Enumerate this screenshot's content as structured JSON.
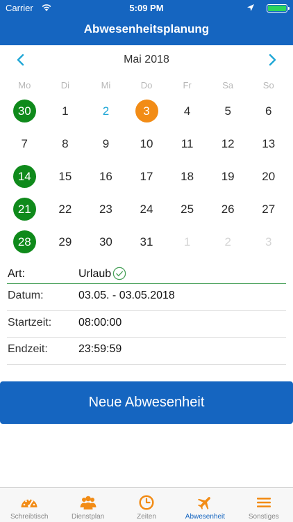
{
  "status_bar": {
    "carrier": "Carrier",
    "time": "5:09 PM"
  },
  "header": {
    "title": "Abwesenheitsplanung"
  },
  "calendar": {
    "month_label": "Mai 2018",
    "weekdays": [
      "Mo",
      "Di",
      "Mi",
      "Do",
      "Fr",
      "Sa",
      "So"
    ],
    "weeks": [
      [
        {
          "d": "30",
          "s": "green"
        },
        {
          "d": "1",
          "s": ""
        },
        {
          "d": "2",
          "s": "today"
        },
        {
          "d": "3",
          "s": "orange"
        },
        {
          "d": "4",
          "s": ""
        },
        {
          "d": "5",
          "s": ""
        },
        {
          "d": "6",
          "s": ""
        }
      ],
      [
        {
          "d": "7",
          "s": ""
        },
        {
          "d": "8",
          "s": ""
        },
        {
          "d": "9",
          "s": ""
        },
        {
          "d": "10",
          "s": ""
        },
        {
          "d": "11",
          "s": ""
        },
        {
          "d": "12",
          "s": ""
        },
        {
          "d": "13",
          "s": ""
        }
      ],
      [
        {
          "d": "14",
          "s": "green"
        },
        {
          "d": "15",
          "s": ""
        },
        {
          "d": "16",
          "s": ""
        },
        {
          "d": "17",
          "s": ""
        },
        {
          "d": "18",
          "s": ""
        },
        {
          "d": "19",
          "s": ""
        },
        {
          "d": "20",
          "s": ""
        }
      ],
      [
        {
          "d": "21",
          "s": "green"
        },
        {
          "d": "22",
          "s": ""
        },
        {
          "d": "23",
          "s": ""
        },
        {
          "d": "24",
          "s": ""
        },
        {
          "d": "25",
          "s": ""
        },
        {
          "d": "26",
          "s": ""
        },
        {
          "d": "27",
          "s": ""
        }
      ],
      [
        {
          "d": "28",
          "s": "green"
        },
        {
          "d": "29",
          "s": ""
        },
        {
          "d": "30",
          "s": ""
        },
        {
          "d": "31",
          "s": ""
        },
        {
          "d": "1",
          "s": "muted"
        },
        {
          "d": "2",
          "s": "muted"
        },
        {
          "d": "3",
          "s": "muted"
        }
      ]
    ]
  },
  "form": {
    "art_label": "Art:",
    "art_value": "Urlaub",
    "datum_label": "Datum:",
    "datum_value": "03.05. - 03.05.2018",
    "start_label": "Startzeit:",
    "start_value": "08:00:00",
    "end_label": "Endzeit:",
    "end_value": "23:59:59"
  },
  "actions": {
    "new_absence": "Neue Abwesenheit"
  },
  "tabs": [
    {
      "label": "Schreibtisch",
      "icon": "dashboard-icon"
    },
    {
      "label": "Dienstplan",
      "icon": "team-icon"
    },
    {
      "label": "Zeiten",
      "icon": "clock-icon"
    },
    {
      "label": "Abwesenheit",
      "icon": "airplane-icon"
    },
    {
      "label": "Sonstiges",
      "icon": "menu-icon"
    }
  ],
  "colors": {
    "primary": "#1565c0",
    "green_day": "#0f8a1b",
    "orange_day": "#f28c16",
    "today": "#1ea6d6",
    "tab_icon": "#f28c16",
    "tab_active": "#1565c0"
  }
}
